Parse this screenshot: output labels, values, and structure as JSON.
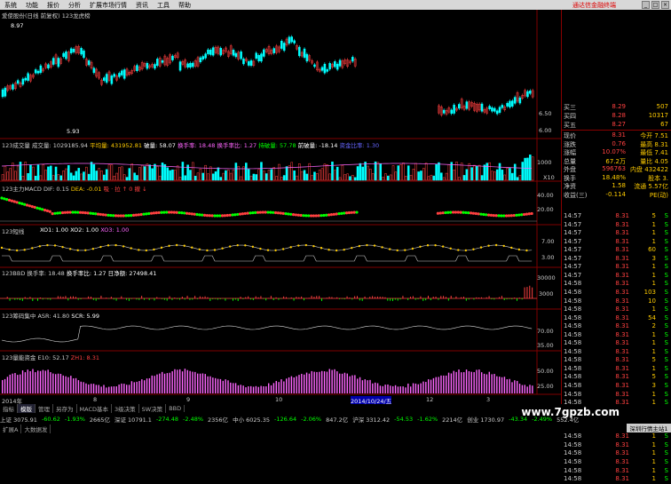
{
  "menu": [
    "系统",
    "功能",
    "报价",
    "分析",
    "扩展市场行情",
    "资讯",
    "工具",
    "帮助"
  ],
  "menu_alert": "通达信金融终端",
  "panels": {
    "main_title": "爱使股份(日线 前复权) 123龙虎榜",
    "price_top": "8.97",
    "price_low": "5.93",
    "vol_title": "123成交量 成交量: 1029185.94",
    "vol_items": [
      {
        "t": "平均量: 431952.81",
        "c": "#ffcc00"
      },
      {
        "t": "破量: 58.07",
        "c": "#fff"
      },
      {
        "t": "换手率: 18.48",
        "c": "#ff66ff"
      },
      {
        "t": "换手率比: 1.27",
        "c": "#ff66ff"
      },
      {
        "t": "持破量: 57.78",
        "c": "#00ff00"
      },
      {
        "t": "前破量: -18.14",
        "c": "#fff"
      },
      {
        "t": "资金比率: 1.30",
        "c": "#6666ff"
      }
    ],
    "macd_title": "123主力MACD DIF: 0.15",
    "macd_items": [
      {
        "t": "DEA: -0.01",
        "c": "#ffcc00"
      },
      {
        "t": "吸 · 拉 ↑ 0 撤 ↓",
        "c": "#ff4040"
      }
    ],
    "p4_title": "123短线",
    "p4_items": [
      {
        "t": "XO1: 1.00",
        "c": "#fff"
      },
      {
        "t": "XO2: 1.00",
        "c": "#fff"
      },
      {
        "t": "XO3: 1.00",
        "c": "#ff66ff"
      }
    ],
    "p5_title": "123BBD 换手率: 18.48",
    "p5_items": [
      {
        "t": "换手率比: 1.27",
        "c": "#fff"
      },
      {
        "t": "日净额: 27498.41",
        "c": "#fff"
      }
    ],
    "p6_title": "123筹码集中 ASR: 41.80",
    "p6_items": [
      {
        "t": "SCR: 5.99",
        "c": "#fff"
      }
    ],
    "p7_title": "123量能资金 E10: 52.17",
    "p7_items": [
      {
        "t": "ZH1: 8.31",
        "c": "#ff4040"
      }
    ],
    "dates": [
      "2014年",
      "8",
      "9",
      "10",
      "2014/10/24/五",
      "12",
      "3"
    ],
    "axis_vol": [
      "1000",
      "X10"
    ],
    "axis_macd": [
      "40.00",
      "20.00"
    ],
    "axis_p4": [
      "7.00",
      "3.00"
    ],
    "axis_p5": [
      "30000",
      "3000"
    ],
    "axis_p6": [
      "70.00",
      "35.00"
    ],
    "axis_p7": [
      "50.00",
      "25.00"
    ],
    "axis_main": [
      "6.50",
      "6.00"
    ]
  },
  "quote": [
    {
      "label": "买三",
      "price": "8.29",
      "vol": "507",
      "pc": "#ff4040"
    },
    {
      "label": "买四",
      "price": "8.28",
      "vol": "10317",
      "pc": "#ff4040"
    },
    {
      "label": "买五",
      "price": "8.27",
      "vol": "67",
      "pc": "#ff4040"
    },
    {
      "label": "现价",
      "price": "8.31",
      "vol": "今开 7.51",
      "pc": "#ff4040"
    },
    {
      "label": "涨跌",
      "price": "0.76",
      "vol": "最高 8.31",
      "pc": "#ff4040"
    },
    {
      "label": "涨幅",
      "price": "10.07%",
      "vol": "最低 7.41",
      "pc": "#ff4040"
    },
    {
      "label": "总量",
      "price": "67.2万",
      "vol": "量比 4.05",
      "pc": "#ffcc00"
    },
    {
      "label": "外盘",
      "price": "596763",
      "vol": "内盘 432422",
      "pc": "#ff4040"
    },
    {
      "label": "换手",
      "price": "18.48%",
      "vol": "股本 3.",
      "pc": "#ffcc00"
    },
    {
      "label": "净资",
      "price": "1.58",
      "vol": "流通 5.57亿",
      "pc": "#ffcc00"
    },
    {
      "label": "收益(三)",
      "price": "-0.114",
      "vol": "PE(动)",
      "pc": "#ffcc00"
    }
  ],
  "ticks": [
    {
      "time": "14:57",
      "price": "8.31",
      "vol": "5",
      "bs": "S"
    },
    {
      "time": "14:57",
      "price": "8.31",
      "vol": "1",
      "bs": "S"
    },
    {
      "time": "14:57",
      "price": "8.31",
      "vol": "1",
      "bs": "S"
    },
    {
      "time": "14:57",
      "price": "8.31",
      "vol": "1",
      "bs": "S"
    },
    {
      "time": "14:57",
      "price": "8.31",
      "vol": "60",
      "bs": "S"
    },
    {
      "time": "14:57",
      "price": "8.31",
      "vol": "3",
      "bs": "S"
    },
    {
      "time": "14:57",
      "price": "8.31",
      "vol": "1",
      "bs": "S"
    },
    {
      "time": "14:57",
      "price": "8.31",
      "vol": "1",
      "bs": "S"
    },
    {
      "time": "14:58",
      "price": "8.31",
      "vol": "1",
      "bs": "S"
    },
    {
      "time": "14:58",
      "price": "8.31",
      "vol": "103",
      "bs": "S"
    },
    {
      "time": "14:58",
      "price": "8.31",
      "vol": "10",
      "bs": "S"
    },
    {
      "time": "14:58",
      "price": "8.31",
      "vol": "1",
      "bs": "S"
    },
    {
      "time": "14:58",
      "price": "8.31",
      "vol": "54",
      "bs": "S"
    },
    {
      "time": "14:58",
      "price": "8.31",
      "vol": "2",
      "bs": "S"
    },
    {
      "time": "14:58",
      "price": "8.31",
      "vol": "1",
      "bs": "S"
    },
    {
      "time": "14:58",
      "price": "8.31",
      "vol": "1",
      "bs": "S"
    },
    {
      "time": "14:58",
      "price": "8.31",
      "vol": "1",
      "bs": "S"
    },
    {
      "time": "14:58",
      "price": "8.31",
      "vol": "5",
      "bs": "S"
    },
    {
      "time": "14:58",
      "price": "8.31",
      "vol": "1",
      "bs": "S"
    },
    {
      "time": "14:58",
      "price": "8.31",
      "vol": "5",
      "bs": "S"
    },
    {
      "time": "14:58",
      "price": "8.31",
      "vol": "3",
      "bs": "S"
    },
    {
      "time": "14:58",
      "price": "8.31",
      "vol": "1",
      "bs": "S"
    },
    {
      "time": "14:58",
      "price": "8.31",
      "vol": "1",
      "bs": "S"
    },
    {
      "time": "14:58",
      "price": "8.31",
      "vol": "1",
      "bs": "S"
    },
    {
      "time": "14:58",
      "price": "8.31",
      "vol": "1",
      "bs": "S"
    },
    {
      "time": "14:58",
      "price": "8.31",
      "vol": "1",
      "bs": "S"
    },
    {
      "time": "14:58",
      "price": "8.31",
      "vol": "1",
      "bs": "S"
    },
    {
      "time": "14:58",
      "price": "8.31",
      "vol": "1",
      "bs": "S"
    },
    {
      "time": "14:58",
      "price": "8.31",
      "vol": "1",
      "bs": "S"
    },
    {
      "time": "14:58",
      "price": "8.31",
      "vol": "1",
      "bs": "S"
    },
    {
      "time": "14:58",
      "price": "8.31",
      "vol": "1",
      "bs": "S"
    },
    {
      "time": "14:58",
      "price": "8.31",
      "vol": "1",
      "bs": "S"
    }
  ],
  "tabs": [
    "指标",
    "模版",
    "管理",
    "另存为",
    "MACD基本",
    "3级决策",
    "SW决策",
    "BBD"
  ],
  "tab_active": 1,
  "index_line": [
    {
      "t": "上证 3075.91",
      "c": "#ccc"
    },
    {
      "t": "-60.62",
      "c": "#00ff00"
    },
    {
      "t": "-1.93%",
      "c": "#00ff00"
    },
    {
      "t": "2665亿",
      "c": "#ccc"
    },
    {
      "t": "深证 10791.1",
      "c": "#ccc"
    },
    {
      "t": "-274.48",
      "c": "#00ff00"
    },
    {
      "t": "-2.48%",
      "c": "#00ff00"
    },
    {
      "t": "2356亿",
      "c": "#ccc"
    },
    {
      "t": "中小 6025.35",
      "c": "#ccc"
    },
    {
      "t": "-126.64",
      "c": "#00ff00"
    },
    {
      "t": "-2.06%",
      "c": "#00ff00"
    },
    {
      "t": "847.2亿",
      "c": "#ccc"
    },
    {
      "t": "沪深 3312.42",
      "c": "#ccc"
    },
    {
      "t": "-54.53",
      "c": "#00ff00"
    },
    {
      "t": "-1.62%",
      "c": "#00ff00"
    },
    {
      "t": "2214亿",
      "c": "#ccc"
    },
    {
      "t": "创业 1730.97",
      "c": "#ccc"
    },
    {
      "t": "-43.34",
      "c": "#00ff00"
    },
    {
      "t": "-2.49%",
      "c": "#00ff00"
    },
    {
      "t": "552.4亿",
      "c": "#ccc"
    }
  ],
  "status": [
    "扩展A",
    "大数据发"
  ],
  "watermark": "www.7gpzb.com",
  "server": "深圳行情主站1",
  "colors": {
    "up": "#ff4040",
    "down": "#00ffff",
    "green": "#00ff00",
    "magenta": "#ff66ff",
    "yellow": "#ffcc00",
    "grid": "#800000"
  }
}
